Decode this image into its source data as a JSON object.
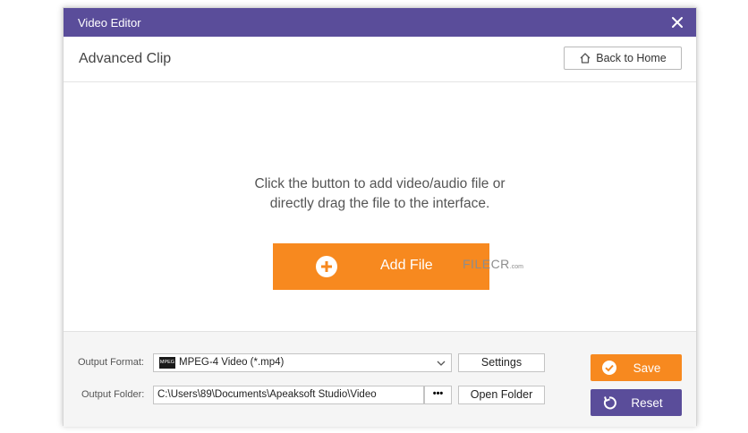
{
  "window": {
    "title": "Video Editor",
    "close_icon": "close-icon"
  },
  "header": {
    "page_title": "Advanced Clip",
    "back_button": "Back to Home",
    "back_icon": "home-icon"
  },
  "drop_area": {
    "hint_line1": "Click the button to add video/audio file or",
    "hint_line2": "directly drag the file to the interface.",
    "add_button": "Add File",
    "add_icon": "plus-circle-icon"
  },
  "watermark": {
    "text": "FILECR",
    "sub": ".com"
  },
  "footer": {
    "output_format_label": "Output Format:",
    "output_format_value": "MPEG-4 Video (*.mp4)",
    "format_icon_text": "MPEG",
    "settings_button": "Settings",
    "output_folder_label": "Output Folder:",
    "output_folder_value": "C:\\Users\\89\\Documents\\Apeaksoft Studio\\Video",
    "browse_button": "•••",
    "open_folder_button": "Open Folder",
    "save_button": "Save",
    "reset_button": "Reset"
  },
  "colors": {
    "titlebar": "#5a4d9a",
    "accent_orange": "#f7891f",
    "accent_purple": "#5a4d9a"
  }
}
